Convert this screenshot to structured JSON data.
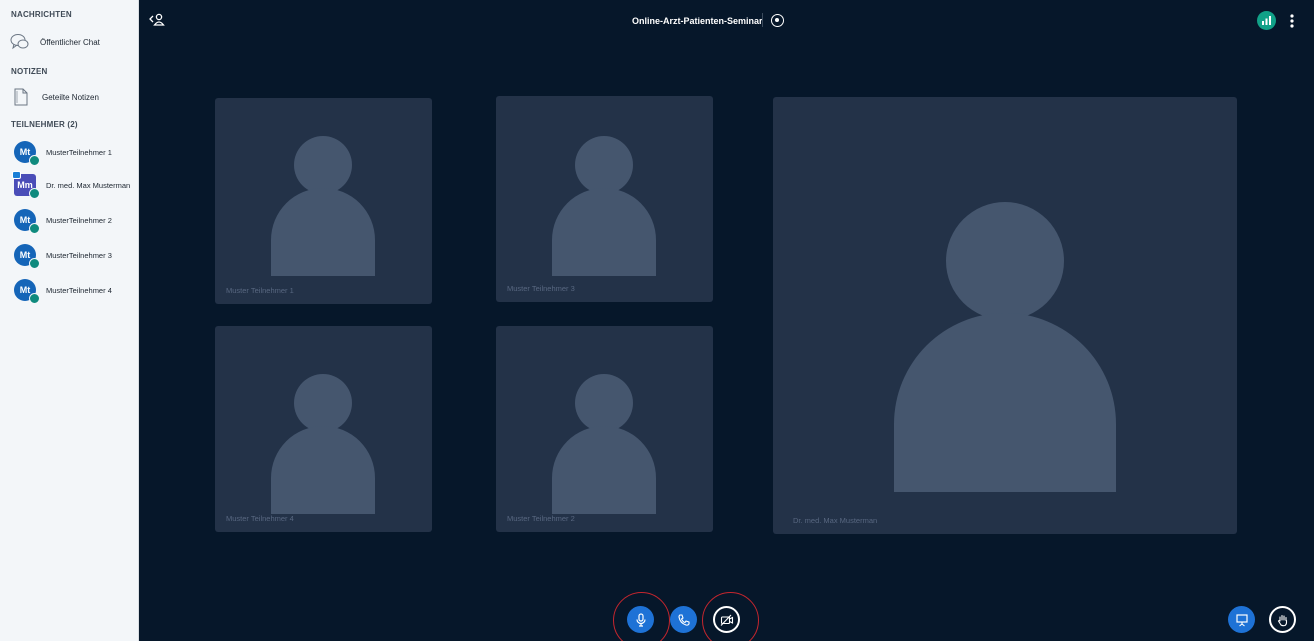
{
  "sidebar": {
    "messages_title": "NACHRICHTEN",
    "public_chat_label": "Öffentlicher Chat",
    "notes_title": "NOTIZEN",
    "shared_notes_label": "Geteilte Notizen",
    "participants_title": "TEILNEHMER (2)",
    "users": [
      {
        "initials": "Mt",
        "name": "MusterTeilnehmer 1",
        "role": "viewer"
      },
      {
        "initials": "Mm",
        "name": "Dr. med. Max Musterman",
        "role": "moderator"
      },
      {
        "initials": "Mt",
        "name": "MusterTeilnehmer 2",
        "role": "viewer"
      },
      {
        "initials": "Mt",
        "name": "MusterTeilnehmer 3",
        "role": "viewer"
      },
      {
        "initials": "Mt",
        "name": "MusterTeilnehmer 4",
        "role": "viewer"
      }
    ]
  },
  "header": {
    "title": "Online-Arzt-Patienten-Seminar"
  },
  "videos": [
    {
      "name": "Muster Teilnehmer 1"
    },
    {
      "name": "Muster Teilnehmer 3"
    },
    {
      "name": "Muster Teilnehmer 4"
    },
    {
      "name": "Muster Teilnehmer 2"
    },
    {
      "name": "Dr. med. Max Musterman"
    }
  ],
  "controls": {
    "mic_icon": "microphone-icon",
    "audio_icon": "phone-icon",
    "camera_icon": "camera-off-icon",
    "presentation_icon": "presentation-icon",
    "hand_icon": "raise-hand-icon"
  },
  "colors": {
    "main_bg": "#06172a",
    "tile_bg": "#233248",
    "placeholder": "#45566e",
    "accent_blue": "#1e72d6",
    "status_green": "#11a188",
    "highlight_red": "#c4262e"
  }
}
